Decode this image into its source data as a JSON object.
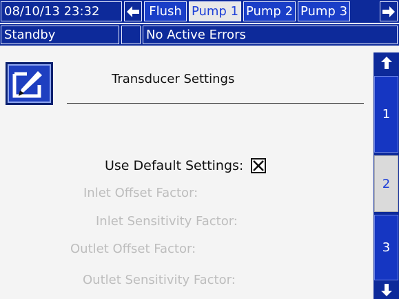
{
  "header": {
    "datetime": "08/10/13 23:32",
    "tabs": [
      {
        "label": "Flush",
        "active": false
      },
      {
        "label": "Pump 1",
        "active": true
      },
      {
        "label": "Pump 2",
        "active": false
      },
      {
        "label": "Pump 3",
        "active": false
      }
    ]
  },
  "status": {
    "mode": "Standby",
    "errors": "No Active Errors"
  },
  "screen": {
    "title": "Transducer Settings",
    "use_default_label": "Use Default Settings:",
    "use_default_checked": true,
    "fields": [
      {
        "label": "Inlet Offset Factor:"
      },
      {
        "label": "Inlet Sensitivity Factor:"
      },
      {
        "label": "Outlet Offset Factor:"
      },
      {
        "label": "Outlet Sensitivity Factor:"
      }
    ]
  },
  "pages": {
    "items": [
      "1",
      "2",
      "3"
    ],
    "current": "2"
  },
  "colors": {
    "bar_blue": "#0d2a9a",
    "tab_blue": "#1a3ec8",
    "active_tab_bg": "#e8e8e8",
    "active_tab_text": "#1e40d8",
    "disabled_text": "#bdbdbd"
  }
}
